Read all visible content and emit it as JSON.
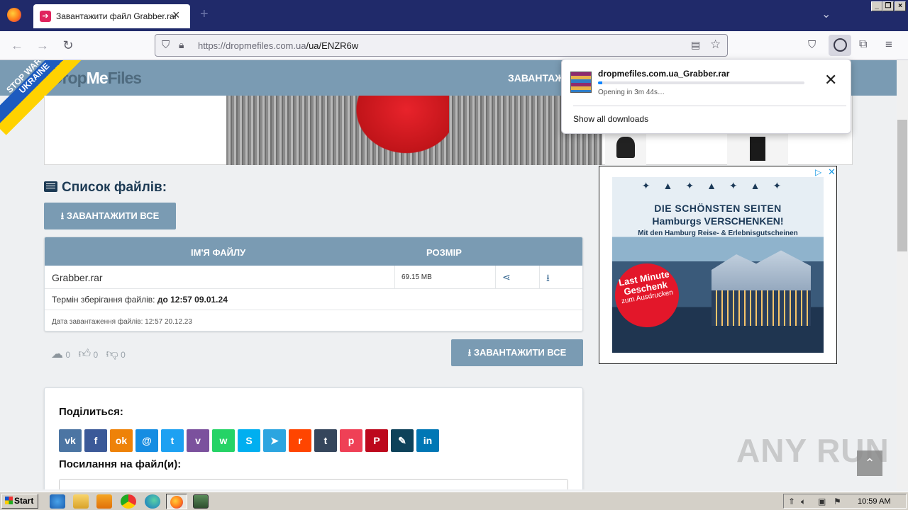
{
  "browser": {
    "tab_title": "Завантажити файл Grabber.rar",
    "url_host": "https://dropmefiles.com.ua",
    "url_path": "/ua/ENZR6w"
  },
  "site": {
    "logo_part1": "Drop",
    "logo_part2": "Me",
    "logo_part3": "Files",
    "nav_download": "ЗАВАНТАЖ",
    "stopwar_text": "STOP WAR IN UKRAINE"
  },
  "files": {
    "heading": "Список файлів:",
    "download_all_label": "ЗАВАНТАЖИТИ ВСЕ",
    "col_name": "ІМ'Я ФАЙЛУ",
    "col_size": "РОЗМІР",
    "file_name": "Grabber.rar",
    "file_size": "69.15 MB",
    "storage_label": "Термін зберігання файлів:",
    "storage_value": "до 12:57 09.01.24",
    "uploaded_text": "Дата завантаження файлів: 12:57 20.12.23"
  },
  "stats": {
    "downloads": "0",
    "likes": "0",
    "dislikes": "0"
  },
  "share": {
    "title": "Поділиться:",
    "link_title": "Посилання на файл(и):",
    "networks": [
      {
        "name": "vk",
        "glyph": "vk",
        "color": "#4c75a3"
      },
      {
        "name": "facebook",
        "glyph": "f",
        "color": "#3b5998"
      },
      {
        "name": "odnoklassniki",
        "glyph": "ok",
        "color": "#ee8208"
      },
      {
        "name": "moimir",
        "glyph": "@",
        "color": "#168de2"
      },
      {
        "name": "twitter",
        "glyph": "t",
        "color": "#1da1f2"
      },
      {
        "name": "viber",
        "glyph": "v",
        "color": "#7b519d"
      },
      {
        "name": "whatsapp",
        "glyph": "w",
        "color": "#25d366"
      },
      {
        "name": "skype",
        "glyph": "S",
        "color": "#00aff0"
      },
      {
        "name": "telegram",
        "glyph": "➤",
        "color": "#2ca5e0"
      },
      {
        "name": "reddit",
        "glyph": "r",
        "color": "#ff4500"
      },
      {
        "name": "tumblr",
        "glyph": "t",
        "color": "#35465c"
      },
      {
        "name": "pocket",
        "glyph": "p",
        "color": "#ef4056"
      },
      {
        "name": "pinterest",
        "glyph": "P",
        "color": "#bd081c"
      },
      {
        "name": "livejournal",
        "glyph": "✎",
        "color": "#0d425a"
      },
      {
        "name": "linkedin",
        "glyph": "in",
        "color": "#0077b5"
      }
    ]
  },
  "ad": {
    "headline1": "DIE SCHÖNSTEN SEITEN",
    "headline2": "Hamburgs VERSCHENKEN!",
    "subline": "Mit den Hamburg Reise- & Erlebnisgutscheinen",
    "badge_line1": "Last Minute Geschenk",
    "badge_line2": "zum Ausdrucken"
  },
  "download_panel": {
    "file_name": "dropmefiles.com.ua_Grabber.rar",
    "status": "Opening in 3m 44s…",
    "progress": 0.02,
    "show_all": "Show all downloads"
  },
  "watermark": "ANY RUN",
  "taskbar": {
    "start_label": "Start",
    "clock": "10:59 AM"
  }
}
